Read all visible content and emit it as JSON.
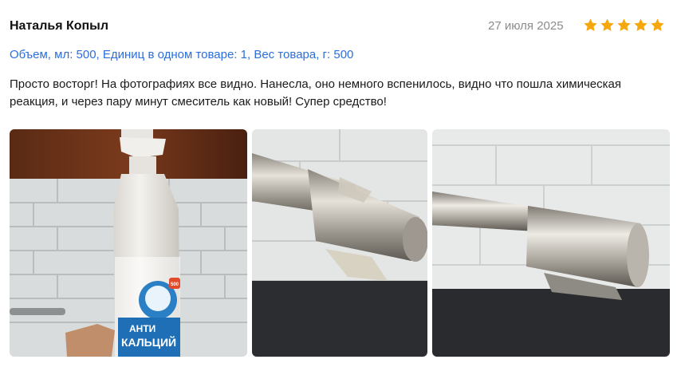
{
  "review": {
    "author": "Наталья Копыл",
    "date": "27 июля 2025",
    "rating": 5,
    "star_color": "#f6a70c",
    "meta": "Объем, мл: 500, Единиц в одном товаре: 1, Вес товара, г: 500",
    "text": "Просто восторг! На фотографиях все видно. Нанесла, оно немного вспенилось, видно что пошла химическая реакция, и через пару минут смеситель как новый! Супер средство!",
    "photos": [
      {
        "name": "review-photo-bottle",
        "bottle_label_line1": "АНТИ",
        "bottle_label_line2": "КАЛЬЦИЙ",
        "badge": "500"
      },
      {
        "name": "review-photo-faucet-before"
      },
      {
        "name": "review-photo-faucet-after"
      }
    ]
  }
}
